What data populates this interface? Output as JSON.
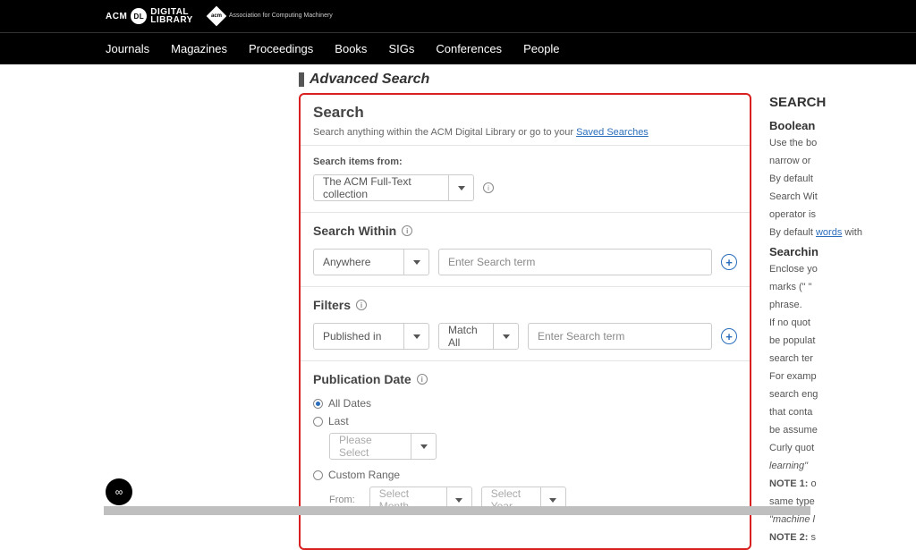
{
  "logo": {
    "acm": "ACM",
    "dl": "DL",
    "digital": "DIGITAL",
    "library": "LIBRARY",
    "sub": "Association for\nComputing Machinery"
  },
  "nav": [
    "Journals",
    "Magazines",
    "Proceedings",
    "Books",
    "SIGs",
    "Conferences",
    "People"
  ],
  "page_title": "Advanced Search",
  "search": {
    "heading": "Search",
    "sub_pre": "Search anything within the ACM Digital Library or go to your ",
    "sub_link": "Saved Searches",
    "items_from_label": "Search items from:",
    "items_from_value": "The ACM Full-Text collection"
  },
  "within": {
    "title": "Search Within",
    "select_value": "Anywhere",
    "placeholder": "Enter Search term"
  },
  "filters": {
    "title": "Filters",
    "field_value": "Published in",
    "match_value": "Match All",
    "placeholder": "Enter Search term"
  },
  "pubdate": {
    "title": "Publication Date",
    "all": "All Dates",
    "last": "Last",
    "last_placeholder": "Please Select",
    "custom": "Custom Range",
    "from_label": "From:",
    "month_placeholder": "Select Month",
    "year_placeholder": "Select Year"
  },
  "tips": {
    "heading": "SEARCH",
    "boolean_h": "Boolean",
    "p1": "Use the bo",
    "p2": "narrow or",
    "p3": "By default",
    "p4": "Search Wit",
    "p5": "operator is",
    "p6_pre": "By default",
    "p6_link": "words",
    "p6_post": " with",
    "searching_h": "Searchin",
    "p7": "Enclose yo",
    "p8": "marks (\" \"",
    "p9": "phrase.",
    "p10": "If no quot",
    "p11": "be populat",
    "p12": "search ter",
    "p13": "For examp",
    "p14": "search eng",
    "p15": "that conta",
    "p16": "be assume",
    "p17": "Curly quot",
    "p18": "learning\"",
    "p19a": "NOTE 1:",
    "p19b": " o",
    "p20": "same type",
    "p21": "\"machine l",
    "p22a": "NOTE 2:",
    "p22b": " s"
  }
}
